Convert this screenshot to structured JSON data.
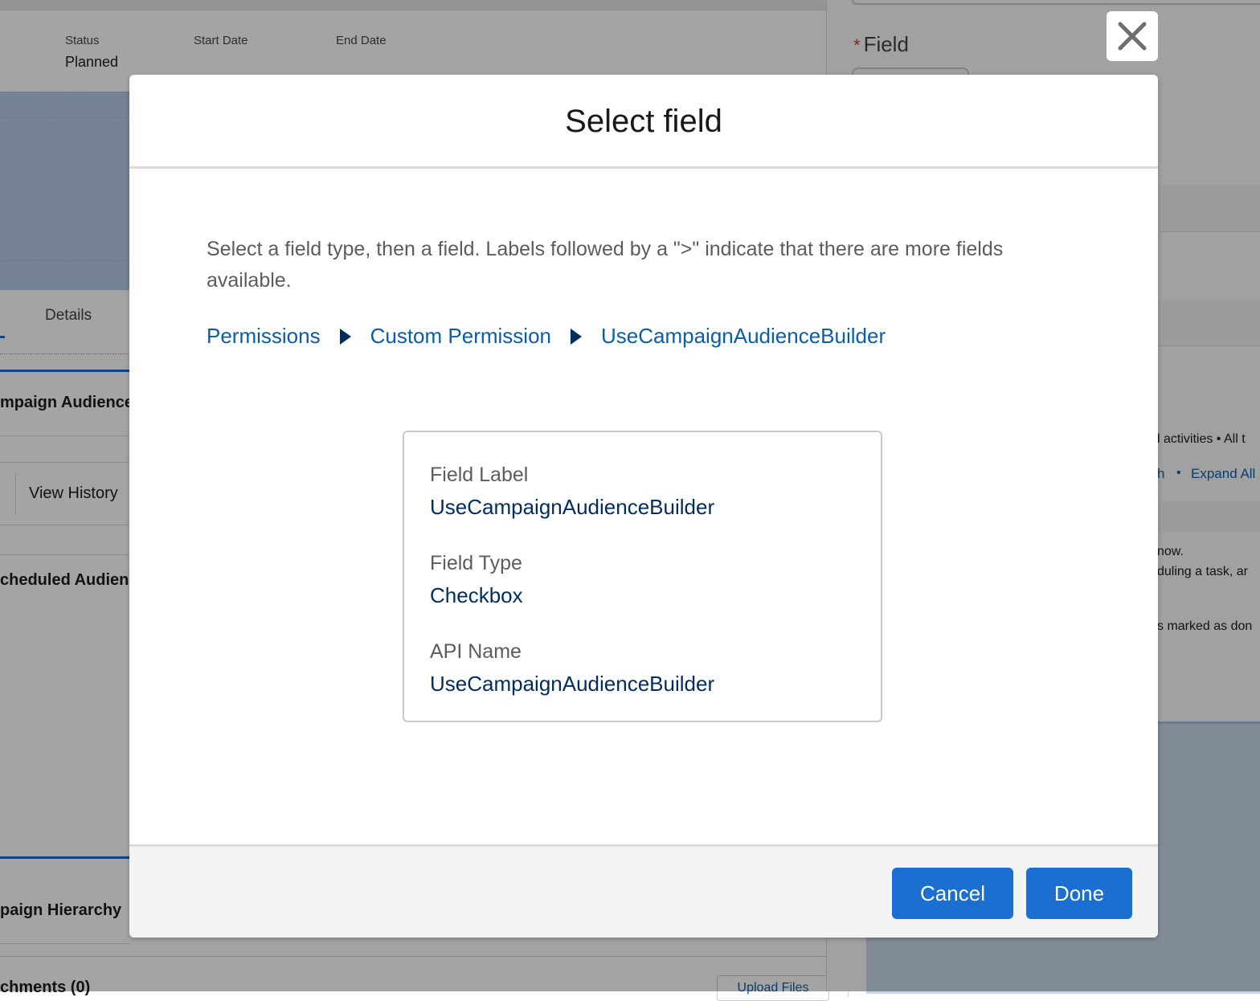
{
  "background": {
    "header_fields": [
      {
        "label": "Status",
        "value": "Planned"
      },
      {
        "label": "Start Date",
        "value": ""
      },
      {
        "label": "End Date",
        "value": ""
      }
    ],
    "details_tab": "Details",
    "section_campaign_audience": "mpaign Audience",
    "view_history": "View History",
    "section_scheduled": "cheduled Audienc",
    "section_hierarchy": "paign Hierarchy",
    "section_attachments": "chments (0)",
    "upload_files": "Upload Files",
    "right_panel": {
      "field_label": "Field",
      "activities_text": "l activities • All t",
      "refresh_link": "h",
      "expand_all_link": "Expand All",
      "line1": "now.",
      "line2": "duling a task, ar",
      "line3": "s marked as don"
    }
  },
  "modal": {
    "title": "Select field",
    "description": "Select a field type, then a field. Labels followed by a \">\" indicate that there are more fields available.",
    "breadcrumb": [
      "Permissions",
      "Custom Permission",
      "UseCampaignAudienceBuilder"
    ],
    "details": {
      "field_label_title": "Field Label",
      "field_label_value": "UseCampaignAudienceBuilder",
      "field_type_title": "Field Type",
      "field_type_value": "Checkbox",
      "api_name_title": "API Name",
      "api_name_value": "UseCampaignAudienceBuilder"
    },
    "buttons": {
      "cancel": "Cancel",
      "done": "Done"
    }
  },
  "colors": {
    "brand_button": "#1b6fd1",
    "link": "#0b5cab",
    "value_text": "#032d60"
  }
}
